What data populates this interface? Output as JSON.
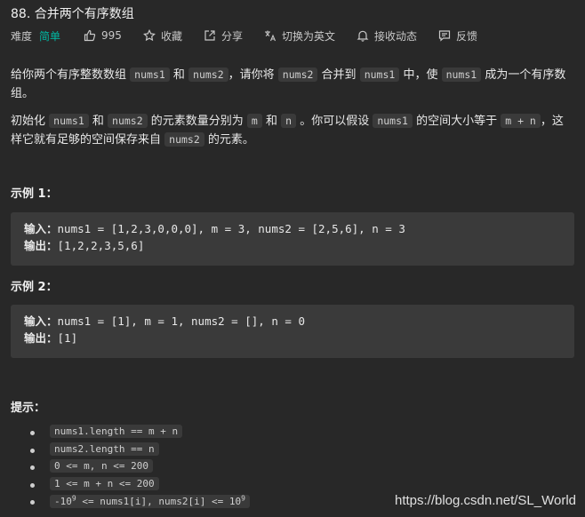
{
  "problem": {
    "title": "88. 合并两个有序数组",
    "difficulty_label": "难度",
    "difficulty_value": "简单"
  },
  "toolbar": {
    "likes": "995",
    "favorite": "收藏",
    "share": "分享",
    "switch_lang": "切换为英文",
    "notify": "接收动态",
    "feedback": "反馈"
  },
  "description": {
    "p1": [
      {
        "t": "给你两个有序整数数组 "
      },
      {
        "c": "nums1"
      },
      {
        "t": " 和 "
      },
      {
        "c": "nums2"
      },
      {
        "t": "，请你将 "
      },
      {
        "c": "nums2"
      },
      {
        "t": " 合并到 "
      },
      {
        "c": "nums1"
      },
      {
        "t": " 中，使 "
      },
      {
        "c": "nums1"
      },
      {
        "t": " 成为一个有序数组。"
      }
    ],
    "p2": [
      {
        "t": "初始化 "
      },
      {
        "c": "nums1"
      },
      {
        "t": " 和 "
      },
      {
        "c": "nums2"
      },
      {
        "t": " 的元素数量分别为 "
      },
      {
        "c": "m"
      },
      {
        "t": " 和 "
      },
      {
        "c": "n"
      },
      {
        "t": " 。你可以假设 "
      },
      {
        "c": "nums1"
      },
      {
        "t": " 的空间大小等于 "
      },
      {
        "c": "m + n"
      },
      {
        "t": "，这样它就有足够的空间保存来自 "
      },
      {
        "c": "nums2"
      },
      {
        "t": " 的元素。"
      }
    ]
  },
  "examples": [
    {
      "heading": "示例 1：",
      "input_label": "输入：",
      "input": "nums1 = [1,2,3,0,0,0], m = 3, nums2 = [2,5,6], n = 3",
      "output_label": "输出：",
      "output": "[1,2,2,3,5,6]"
    },
    {
      "heading": "示例 2：",
      "input_label": "输入：",
      "input": "nums1 = [1], m = 1, nums2 = [], n = 0",
      "output_label": "输出：",
      "output": "[1]"
    }
  ],
  "tips": {
    "heading": "提示：",
    "items": [
      "nums1.length == m + n",
      "nums2.length == n",
      "0 <= m, n <= 200",
      "1 <= m + n <= 200"
    ],
    "last_item": {
      "pre": "-10",
      "sup1": "9",
      "mid": " <= nums1[i], nums2[i] <= 10",
      "sup2": "9"
    }
  },
  "watermark": "https://blog.csdn.net/SL_World"
}
